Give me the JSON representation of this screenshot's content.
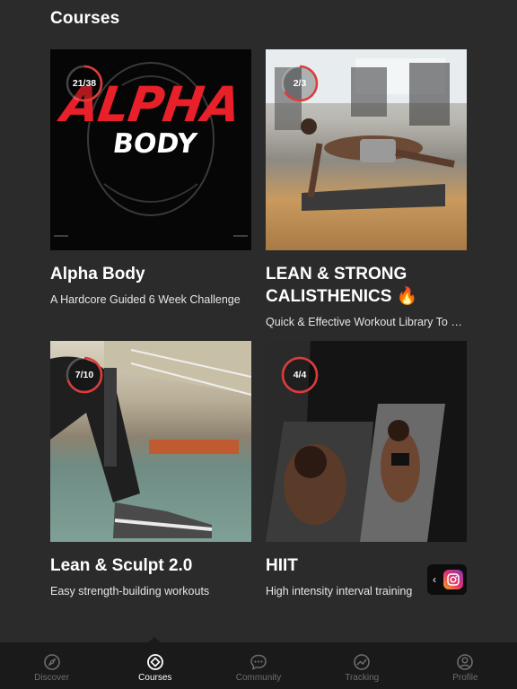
{
  "header": {
    "title": "Courses"
  },
  "courses": [
    {
      "title": "Alpha Body",
      "subtitle": "A Hardcore Guided 6 Week  Challenge",
      "progress_label": "21/38",
      "progress": 0.55,
      "image_text_1": "ALPHA",
      "image_text_2": "BODY"
    },
    {
      "title": "LEAN & STRONG CALISTHENICS 🔥",
      "subtitle": "Quick & Effective Workout Library To Bui...",
      "progress_label": "2/3",
      "progress": 0.67
    },
    {
      "title": "Lean & Sculpt 2.0",
      "subtitle": "Easy strength-building workouts",
      "progress_label": "7/10",
      "progress": 0.7
    },
    {
      "title": "HIIT",
      "subtitle": "High intensity interval training",
      "progress_label": "4/4",
      "progress": 1.0
    }
  ],
  "share": {
    "chevron": "‹",
    "icon": "instagram-icon"
  },
  "tabbar": {
    "items": [
      {
        "label": "Discover",
        "icon": "compass-icon"
      },
      {
        "label": "Courses",
        "icon": "courses-icon"
      },
      {
        "label": "Community",
        "icon": "chat-icon"
      },
      {
        "label": "Tracking",
        "icon": "tracking-icon"
      },
      {
        "label": "Profile",
        "icon": "profile-icon"
      }
    ],
    "active_index": 1
  },
  "colors": {
    "background": "#2b2b2b",
    "accent": "#e03a3a",
    "tabbar": "#1a1a1a"
  }
}
